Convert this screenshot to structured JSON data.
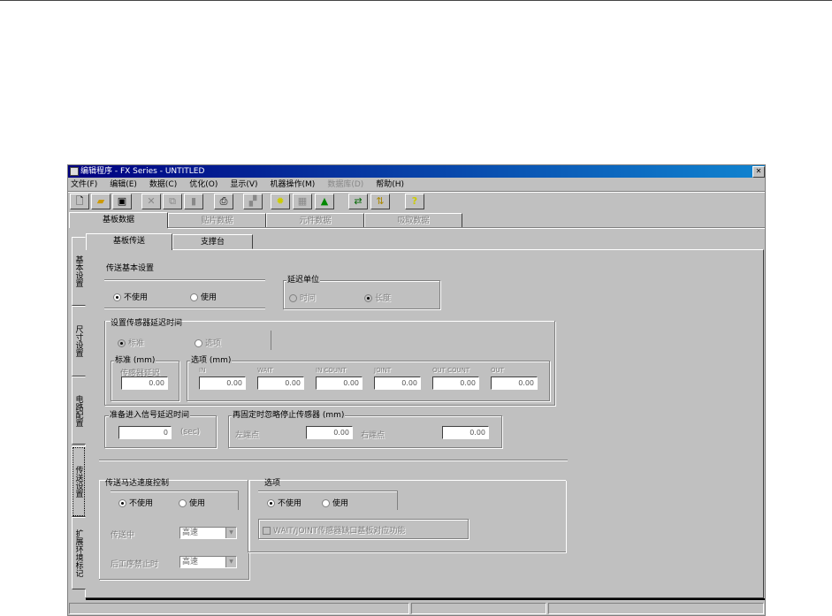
{
  "window": {
    "title": "编辑程序 - FX Series - UNTITLED"
  },
  "menu": [
    "文件(F)",
    "编辑(E)",
    "数据(C)",
    "优化(O)",
    "显示(V)",
    "机器操作(M)",
    "数据库(D)",
    "帮助(H)"
  ],
  "toolbar": {
    "help": "?"
  },
  "main_tabs": [
    "基板数据",
    "贴片数据",
    "元件数据",
    "吸取数据"
  ],
  "sub_tabs": [
    "基板传送",
    "支撑台"
  ],
  "side_tabs": [
    "基本设置",
    "尺寸设置",
    "电路配置",
    "传送设置",
    "扩展环境标记"
  ],
  "transfer_basic": {
    "title": "传送基本设置",
    "options": [
      "不使用",
      "使用"
    ],
    "selected": "不使用"
  },
  "delay_unit": {
    "title": "延迟单位",
    "options": [
      "时间",
      "长度"
    ],
    "selected": "长度"
  },
  "sensor_delay": {
    "title": "设置传感器延迟时间",
    "options": [
      "标准",
      "选项"
    ],
    "selected": "标准",
    "standard": {
      "title": "标准 (mm)",
      "label": "传感器延迟",
      "value": "0.00"
    },
    "option": {
      "title": "选项 (mm)",
      "fields": [
        {
          "label": "IN",
          "value": "0.00"
        },
        {
          "label": "WAIT",
          "value": "0.00"
        },
        {
          "label": "IN COUNT",
          "value": "0.00"
        },
        {
          "label": "JOINT",
          "value": "0.00"
        },
        {
          "label": "OUT COUNT",
          "value": "0.00"
        },
        {
          "label": "OUT",
          "value": "0.00"
        }
      ]
    }
  },
  "ready_delay": {
    "title": "准备进入信号延迟时间",
    "value": "0",
    "unit": "(sec)"
  },
  "refix": {
    "title": "再固定时忽略停止传感器 (mm)",
    "left_label": "左端点",
    "left_value": "0.00",
    "right_label": "右端点",
    "right_value": "0.00"
  },
  "motor": {
    "title": "传送马达速度控制",
    "options": [
      "不使用",
      "使用"
    ],
    "selected": "不使用",
    "during_label": "传送中",
    "during_value": "高速",
    "after_label": "后工序禁止时",
    "after_value": "高速"
  },
  "option_group": {
    "title": "选项",
    "options": [
      "不使用",
      "使用"
    ],
    "selected": "不使用",
    "checkbox_label": "WAIT/JOINT传感器缺口基板对应功能",
    "checked": false
  }
}
